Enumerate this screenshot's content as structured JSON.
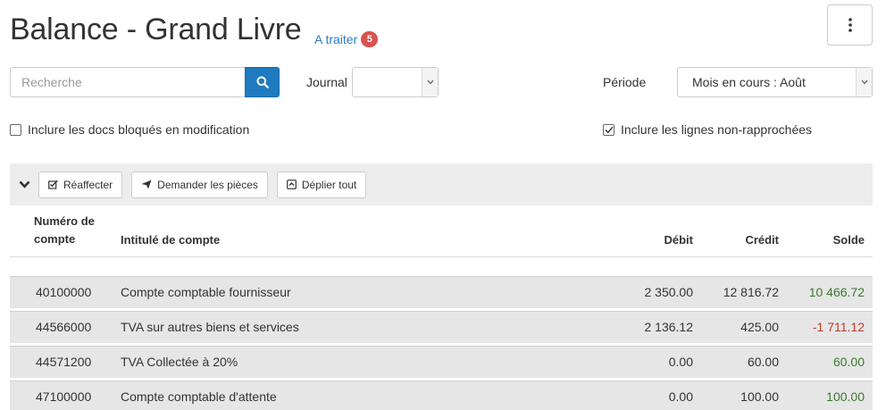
{
  "header": {
    "title": "Balance - Grand Livre",
    "todo_label": "A traiter",
    "todo_count": "5"
  },
  "filters": {
    "search_placeholder": "Recherche",
    "journal_label": "Journal",
    "journal_value": "",
    "period_label": "Période",
    "period_value": "Mois en cours : Août",
    "include_locked_label": "Inclure les docs bloqués en modification",
    "include_locked_checked": false,
    "include_unreconciled_label": "Inclure les lignes non-rapprochées",
    "include_unreconciled_checked": true
  },
  "toolbar": {
    "reassign_label": "Réaffecter",
    "request_docs_label": "Demander les pièces",
    "expand_all_label": "Déplier tout"
  },
  "table": {
    "columns": {
      "account_number_line1": "Numéro de",
      "account_number_line2": "compte",
      "account_name": "Intitulé de compte",
      "debit": "Débit",
      "credit": "Crédit",
      "balance": "Solde"
    },
    "rows": [
      {
        "account": "40100000",
        "name": "Compte comptable fournisseur",
        "debit": "2 350.00",
        "credit": "12 816.72",
        "balance": "10 466.72",
        "sign": "pos"
      },
      {
        "account": "44566000",
        "name": "TVA sur autres biens et services",
        "debit": "2 136.12",
        "credit": "425.00",
        "balance": "-1 711.12",
        "sign": "neg"
      },
      {
        "account": "44571200",
        "name": "TVA Collectée à 20%",
        "debit": "0.00",
        "credit": "60.00",
        "balance": "60.00",
        "sign": "pos"
      },
      {
        "account": "47100000",
        "name": "Compte comptable d'attente",
        "debit": "0.00",
        "credit": "100.00",
        "balance": "100.00",
        "sign": "pos"
      }
    ]
  },
  "colors": {
    "primary": "#1f7ac0",
    "badge": "#d9534f",
    "positive": "#3c7a2e",
    "negative": "#c0392b"
  }
}
